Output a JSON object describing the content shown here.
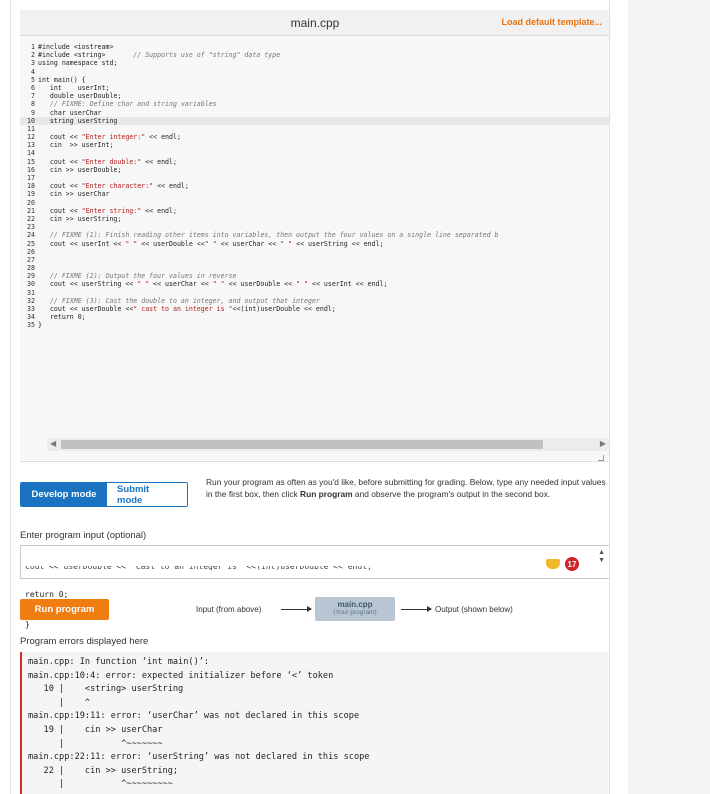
{
  "editor": {
    "filename": "main.cpp",
    "load_default_label": "Load default template...",
    "lines": [
      {
        "n": "1",
        "text": "#include <iostream>"
      },
      {
        "n": "2",
        "text": "#include <string>       // Supports use of \"string\" data type"
      },
      {
        "n": "3",
        "text": "using namespace std;"
      },
      {
        "n": "4",
        "text": ""
      },
      {
        "n": "5",
        "text": "int main() {"
      },
      {
        "n": "6",
        "text": "   int    userInt;"
      },
      {
        "n": "7",
        "text": "   double userDouble;"
      },
      {
        "n": "8",
        "text": "   // FIXME: Define char and string variables"
      },
      {
        "n": "9",
        "text": "   char userChar"
      },
      {
        "n": "10",
        "text": "   string userString"
      },
      {
        "n": "11",
        "text": ""
      },
      {
        "n": "12",
        "text": "   cout << \"Enter integer:\" << endl;"
      },
      {
        "n": "13",
        "text": "   cin  >> userInt;"
      },
      {
        "n": "14",
        "text": ""
      },
      {
        "n": "15",
        "text": "   cout << \"Enter double:\" << endl;"
      },
      {
        "n": "16",
        "text": "   cin >> userDouble;"
      },
      {
        "n": "17",
        "text": ""
      },
      {
        "n": "18",
        "text": "   cout << \"Enter character:\" << endl;"
      },
      {
        "n": "19",
        "text": "   cin >> userChar"
      },
      {
        "n": "20",
        "text": ""
      },
      {
        "n": "21",
        "text": "   cout << \"Enter string:\" << endl;"
      },
      {
        "n": "22",
        "text": "   cin >> userString;"
      },
      {
        "n": "23",
        "text": ""
      },
      {
        "n": "24",
        "text": "   // FIXME (1): Finish reading other items into variables, then output the four values on a single line separated b"
      },
      {
        "n": "25",
        "text": "   cout << userInt << \" \" << userDouble <<\" \" << userChar << \" \" << userString << endl;"
      },
      {
        "n": "26",
        "text": ""
      },
      {
        "n": "27",
        "text": ""
      },
      {
        "n": "28",
        "text": ""
      },
      {
        "n": "29",
        "text": "   // FIXME (2): Output the four values in reverse"
      },
      {
        "n": "30",
        "text": "   cout << userString << \" \" << userChar << \" \" << userDouble << \" \" << userInt << endl;"
      },
      {
        "n": "31",
        "text": ""
      },
      {
        "n": "32",
        "text": "   // FIXME (3): Cast the double to an integer, and output that integer"
      },
      {
        "n": "33",
        "text": "   cout << userDouble <<\" cast to an integer is \"<<(int)userDouble << endl;"
      },
      {
        "n": "34",
        "text": "   return 0;"
      },
      {
        "n": "35",
        "text": "}"
      }
    ],
    "active_line": 10
  },
  "modes": {
    "develop_label": "Develop mode",
    "submit_label": "Submit mode",
    "active": "develop",
    "description_pre": "Run your program as often as you'd like, before submitting for grading. Below, type any needed input values in the first box, then click ",
    "description_bold": "Run program",
    "description_post": " and observe the program's output in the second box."
  },
  "input": {
    "label": "Enter program input (optional)",
    "clipped_line": "cout << userDouble <<\" cast to an integer is \"<<(int)userDouble << endl;",
    "lines": [
      "return 0;",
      "}"
    ],
    "extension_badge": "17"
  },
  "run": {
    "button_label": "Run program",
    "input_label": "Input (from above)",
    "box_title": "main.cpp",
    "box_subtitle": "(Your program)",
    "output_label": "Output (shown below)"
  },
  "errors": {
    "label": "Program errors displayed here",
    "text": "main.cpp: In function ‘int main()’:\nmain.cpp:10:4: error: expected initializer before ‘<’ token\n   10 |    <string> userString\n      |    ^\nmain.cpp:19:11: error: ‘userChar’ was not declared in this scope\n   19 |    cin >> userChar\n      |           ^~~~~~~~\nmain.cpp:22:11: error: ‘userString’ was not declared in this scope\n   22 |    cin >> userString;\n      |           ^~~~~~~~~~"
  },
  "colors": {
    "accent_orange": "#f07d12",
    "mode_blue": "#1a73c1",
    "error_red": "#d32f2f"
  }
}
